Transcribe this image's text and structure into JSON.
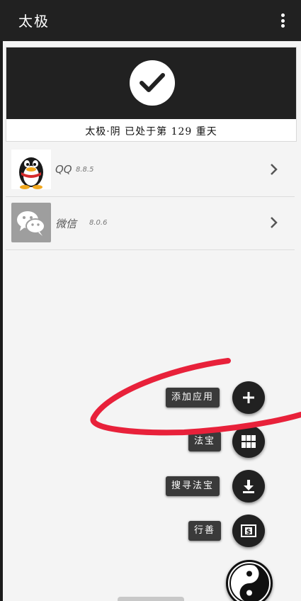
{
  "appbar": {
    "title": "太极",
    "menu_icon": "more-vert-icon"
  },
  "status": {
    "icon": "check-circle-icon",
    "text": "太极·阴 已处于第 129 重天"
  },
  "apps": [
    {
      "name": "QQ",
      "version": "8.8.5",
      "icon": "qq-penguin-icon"
    },
    {
      "name": "微信",
      "version": "8.0.6",
      "icon": "wechat-icon"
    }
  ],
  "fab_actions": [
    {
      "label": "添加应用",
      "icon": "plus-icon"
    },
    {
      "label": "法宝",
      "icon": "grid-icon"
    },
    {
      "label": "搜寻法宝",
      "icon": "download-icon"
    },
    {
      "label": "行善",
      "icon": "donate-icon"
    }
  ],
  "main_fab": {
    "icon": "taiji-yin-yang-icon"
  },
  "colors": {
    "appbar": "#212121",
    "background": "#f4f4f4",
    "scribble": "#e8213a"
  }
}
